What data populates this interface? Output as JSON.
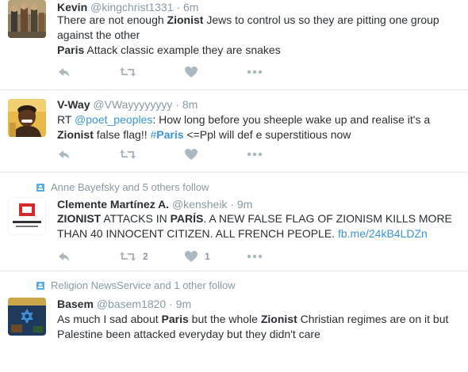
{
  "tweets": [
    {
      "context": "",
      "fullname": "Kevin",
      "handle": "@kingchrist1331",
      "time": "6m",
      "line1": [
        {
          "t": "There are not enough ",
          "s": "normal"
        },
        {
          "t": "Zionist",
          "s": "bold"
        },
        {
          "t": " Jews to control us so they are pitting one group",
          "s": "normal"
        }
      ],
      "line2": [
        {
          "t": "against the other",
          "s": "normal"
        }
      ],
      "line3": [
        {
          "t": "Paris",
          "s": "bold"
        },
        {
          "t": " Attack classic example they are snakes",
          "s": "normal"
        }
      ],
      "retweets": "",
      "likes": ""
    },
    {
      "context": "",
      "fullname": "V-Way",
      "handle": "@VWayyyyyyyy",
      "time": "8m",
      "line1": [
        {
          "t": "RT ",
          "s": "normal"
        },
        {
          "t": "@poet_peoples",
          "s": "link"
        },
        {
          "t": ": How long before you sheeple wake up and realise it's a",
          "s": "normal"
        }
      ],
      "line2": [
        {
          "t": "Zionist",
          "s": "bold"
        },
        {
          "t": " false flag!! ",
          "s": "normal"
        },
        {
          "t": "#",
          "s": "link"
        },
        {
          "t": "Paris",
          "s": "linkbold"
        },
        {
          "t": " <=Ppl will def e superstitious now",
          "s": "normal"
        }
      ],
      "retweets": "",
      "likes": ""
    },
    {
      "context": "Anne Bayefsky and 5 others follow",
      "fullname": "Clemente Martínez A.",
      "handle": "@kensheik",
      "time": "9m",
      "line1": [
        {
          "t": "ZIONIST",
          "s": "bold"
        },
        {
          "t": " ATTACKS IN ",
          "s": "normal"
        },
        {
          "t": "PARÍS",
          "s": "bold"
        },
        {
          "t": ". A NEW FALSE FLAG OF ZIONISM KILLS MORE",
          "s": "normal"
        }
      ],
      "line2": [
        {
          "t": "THAN 40 INNOCENT CITIZEN. ALL FRENCH PEOPLE. ",
          "s": "normal"
        },
        {
          "t": "fb.me/24kB4LDZn",
          "s": "link"
        }
      ],
      "retweets": "2",
      "likes": "1"
    },
    {
      "context": "Religion NewsService and 1 other follow",
      "fullname": "Basem",
      "handle": "@basem1820",
      "time": "9m",
      "line1": [
        {
          "t": "As much I sad about ",
          "s": "normal"
        },
        {
          "t": "Paris",
          "s": "bold"
        },
        {
          "t": " but the whole ",
          "s": "normal"
        },
        {
          "t": "Zionist",
          "s": "bold"
        },
        {
          "t": " Christian regimes are on it but",
          "s": "normal"
        }
      ],
      "line2": [
        {
          "t": "Palestine been attacked everyday but they didn't care",
          "s": "normal"
        }
      ],
      "retweets": "",
      "likes": ""
    }
  ],
  "icons": {
    "reply": "reply-icon",
    "retweet": "retweet-icon",
    "like": "heart-icon",
    "more": "more-icon",
    "follow_context": "person-icon"
  },
  "colors": {
    "link": "#3b94d9",
    "muted": "#8899a6",
    "action": "#aab8c2",
    "divider": "#e1e8ed"
  }
}
